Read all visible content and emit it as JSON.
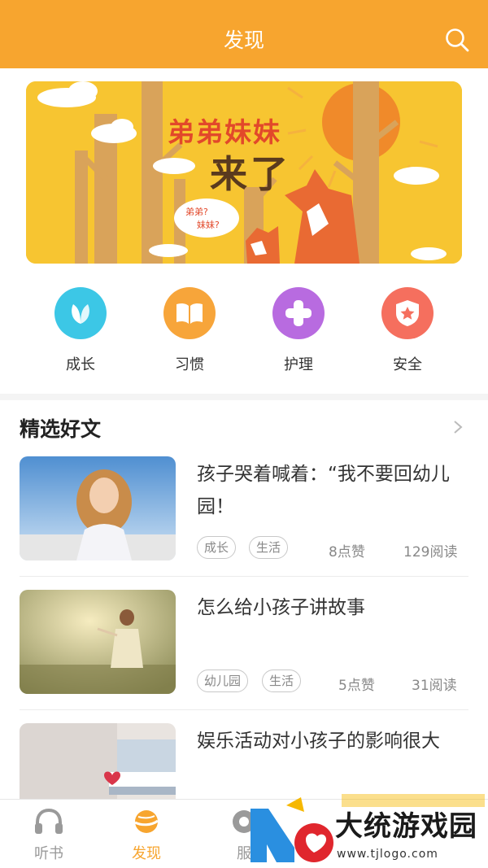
{
  "header": {
    "title": "发现"
  },
  "banner": {
    "line1": "弟弟妹妹",
    "line2": "来了",
    "cloud_line1": "弟弟?",
    "cloud_line2": "妹妹?"
  },
  "categories": [
    {
      "label": "成长",
      "icon": "leaf-icon",
      "color": "#3cc7e6"
    },
    {
      "label": "习惯",
      "icon": "book-icon",
      "color": "#f7a53a"
    },
    {
      "label": "护理",
      "icon": "plus-icon",
      "color": "#b86be0"
    },
    {
      "label": "安全",
      "icon": "shield-star-icon",
      "color": "#f56f5e"
    }
  ],
  "section": {
    "title": "精选好文"
  },
  "articles": [
    {
      "title": "孩子哭着喊着：“我不要回幼儿园！",
      "tags": [
        "成长",
        "生活"
      ],
      "likes": "8点赞",
      "reads": "129阅读"
    },
    {
      "title": "怎么给小孩子讲故事",
      "tags": [
        "幼儿园",
        "生活"
      ],
      "likes": "5点赞",
      "reads": "31阅读"
    },
    {
      "title": "娱乐活动对小孩子的影响很大",
      "tags": [],
      "likes": "",
      "reads": ""
    }
  ],
  "tabbar": {
    "items": [
      {
        "label": "听书",
        "icon": "headphones-icon",
        "active": false
      },
      {
        "label": "发现",
        "icon": "planet-icon",
        "active": true
      },
      {
        "label": "服",
        "icon": "service-icon",
        "active": false
      }
    ]
  },
  "watermark": {
    "name": "大统游戏园",
    "url": "www.tjlogo.com"
  },
  "colors": {
    "accent": "#f7a52f",
    "banner_bg": "#f7c531"
  }
}
